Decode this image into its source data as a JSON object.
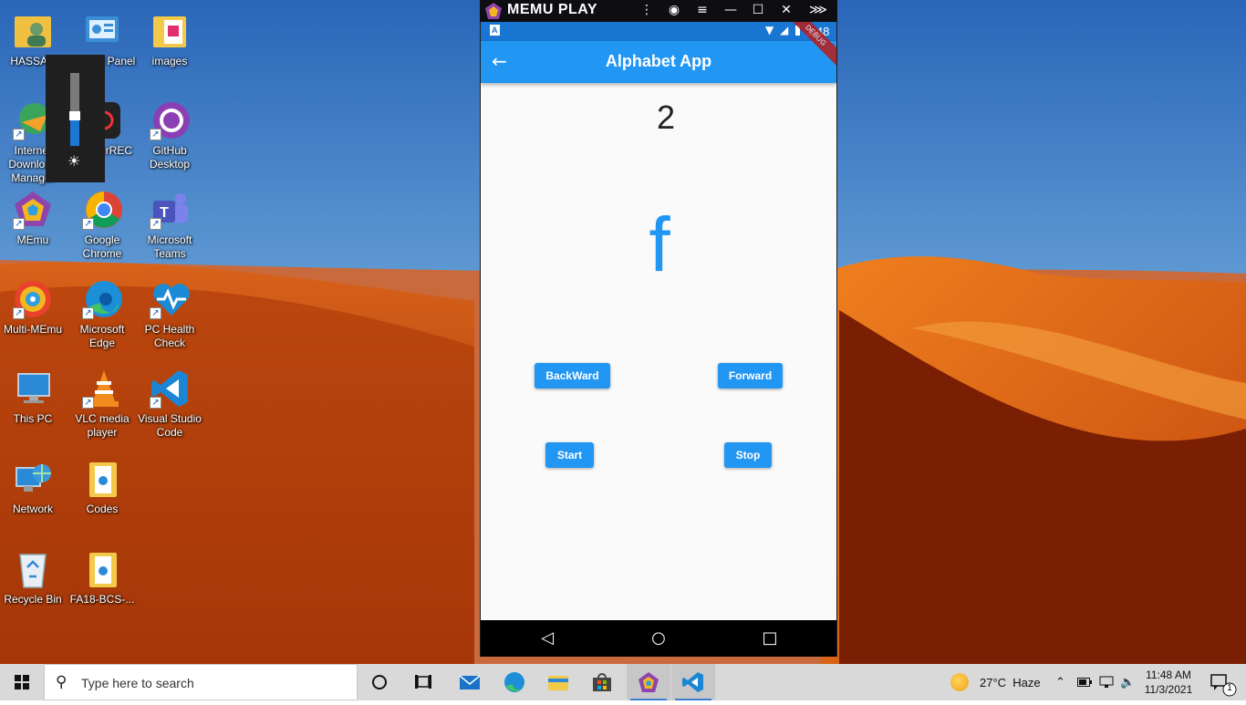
{
  "desktop": {
    "icons": [
      {
        "label": "HASSAN"
      },
      {
        "label": "Control Panel"
      },
      {
        "label": "images"
      },
      {
        "label": "Internet Download Manager"
      },
      {
        "label": "ApowerREC"
      },
      {
        "label": "GitHub Desktop"
      },
      {
        "label": "MEmu"
      },
      {
        "label": "Google Chrome"
      },
      {
        "label": "Microsoft Teams"
      },
      {
        "label": "Multi-MEmu"
      },
      {
        "label": "Microsoft Edge"
      },
      {
        "label": "PC Health Check"
      },
      {
        "label": "This PC"
      },
      {
        "label": "VLC media player"
      },
      {
        "label": "Visual Studio Code"
      },
      {
        "label": "Network"
      },
      {
        "label": "Codes"
      },
      {
        "label": "Recycle Bin"
      },
      {
        "label": "FA18-BCS-..."
      }
    ],
    "brightness_level": 0.35
  },
  "memu": {
    "title": "MEMU PLAY",
    "window_controls": [
      "⋮",
      "◉",
      "≡",
      "—",
      "☐",
      "✕",
      "⋙"
    ]
  },
  "android": {
    "status": {
      "time": "2:48",
      "notification": "A"
    },
    "appbar": {
      "title": "Alphabet App",
      "back_icon": "←",
      "debug_label": "DEBUG"
    },
    "counter": "2",
    "letter": "f",
    "buttons": {
      "backward": "BackWard",
      "forward": "Forward",
      "start": "Start",
      "stop": "Stop"
    },
    "nav": {
      "back": "◁",
      "home": "○",
      "recents": "□"
    }
  },
  "taskbar": {
    "search_placeholder": "Type here to search",
    "weather": "27°C  Haze",
    "time": "11:48 AM",
    "date": "11/3/2021",
    "notification_count": "1"
  }
}
